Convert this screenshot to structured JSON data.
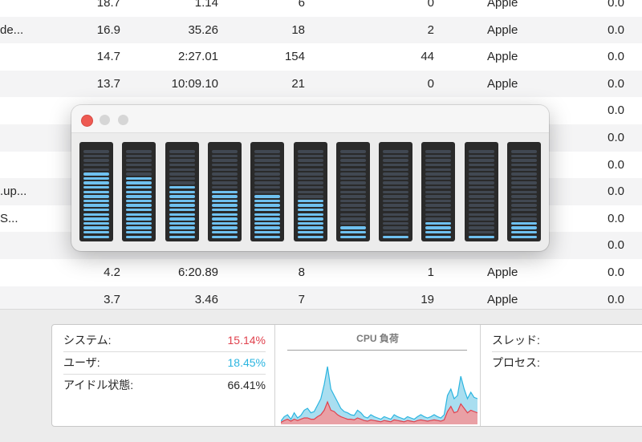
{
  "process_table": {
    "rows": [
      {
        "name": "",
        "cpu": "18.7",
        "time": "1.14",
        "threads": "6",
        "idle_wake": "0",
        "user": "Apple",
        "gpu": "0.0"
      },
      {
        "name": "de...",
        "cpu": "16.9",
        "time": "35.26",
        "threads": "18",
        "idle_wake": "2",
        "user": "Apple",
        "gpu": "0.0"
      },
      {
        "name": "",
        "cpu": "14.7",
        "time": "2:27.01",
        "threads": "154",
        "idle_wake": "44",
        "user": "Apple",
        "gpu": "0.0"
      },
      {
        "name": "",
        "cpu": "13.7",
        "time": "10:09.10",
        "threads": "21",
        "idle_wake": "0",
        "user": "Apple",
        "gpu": "0.0"
      },
      {
        "name": "",
        "cpu": "",
        "time": "",
        "threads": "",
        "idle_wake": "",
        "user": "",
        "gpu": "0.0"
      },
      {
        "name": "",
        "cpu": "",
        "time": "",
        "threads": "",
        "idle_wake": "",
        "user": "",
        "gpu": "0.0"
      },
      {
        "name": "",
        "cpu": "",
        "time": "",
        "threads": "",
        "idle_wake": "",
        "user": "",
        "gpu": "0.0"
      },
      {
        "name": ".up...",
        "cpu": "",
        "time": "",
        "threads": "",
        "idle_wake": "",
        "user": "",
        "gpu": "0.0"
      },
      {
        "name": "S...",
        "cpu": "",
        "time": "",
        "threads": "",
        "idle_wake": "",
        "user": "",
        "gpu": "0.0"
      },
      {
        "name": "",
        "cpu": "",
        "time": "",
        "threads": "",
        "idle_wake": "",
        "user": "",
        "gpu": "0.0"
      },
      {
        "name": "",
        "cpu": "4.2",
        "time": "6:20.89",
        "threads": "8",
        "idle_wake": "1",
        "user": "Apple",
        "gpu": "0.0"
      },
      {
        "name": "",
        "cpu": "3.7",
        "time": "3.46",
        "threads": "7",
        "idle_wake": "19",
        "user": "Apple",
        "gpu": "0.0"
      }
    ]
  },
  "cpu_panel": {
    "system_label": "システム:",
    "system_value": "15.14%",
    "user_label": "ユーザ:",
    "user_value": "18.45%",
    "idle_label": "アイドル状態:",
    "idle_value": "66.41%",
    "graph_title": "CPU 負荷",
    "threads_label": "スレッド:",
    "processes_label": "プロセス:",
    "colors": {
      "system": "#e0424e",
      "user": "#2bb5e0"
    },
    "load_history": {
      "user": [
        0.05,
        0.12,
        0.15,
        0.08,
        0.18,
        0.1,
        0.14,
        0.22,
        0.25,
        0.18,
        0.2,
        0.3,
        0.4,
        0.62,
        0.9,
        0.55,
        0.45,
        0.35,
        0.25,
        0.2,
        0.18,
        0.15,
        0.14,
        0.22,
        0.18,
        0.12,
        0.1,
        0.15,
        0.12,
        0.1,
        0.08,
        0.12,
        0.1,
        0.08,
        0.15,
        0.12,
        0.1,
        0.08,
        0.12,
        0.1,
        0.08,
        0.12,
        0.15,
        0.12,
        0.1,
        0.12,
        0.15,
        0.12,
        0.1,
        0.15,
        0.45,
        0.55,
        0.4,
        0.45,
        0.75,
        0.55,
        0.4,
        0.5,
        0.42,
        0.4
      ],
      "system": [
        0.03,
        0.06,
        0.08,
        0.05,
        0.08,
        0.06,
        0.08,
        0.1,
        0.1,
        0.08,
        0.08,
        0.12,
        0.15,
        0.22,
        0.35,
        0.22,
        0.2,
        0.15,
        0.12,
        0.1,
        0.08,
        0.08,
        0.07,
        0.1,
        0.08,
        0.06,
        0.05,
        0.07,
        0.06,
        0.05,
        0.04,
        0.06,
        0.05,
        0.04,
        0.07,
        0.06,
        0.05,
        0.04,
        0.06,
        0.05,
        0.04,
        0.06,
        0.07,
        0.06,
        0.05,
        0.06,
        0.07,
        0.06,
        0.05,
        0.07,
        0.2,
        0.28,
        0.18,
        0.2,
        0.32,
        0.25,
        0.18,
        0.22,
        0.2,
        0.18
      ]
    }
  },
  "cpu_history_window": {
    "segments_per_meter": 20,
    "core_lit_segments": [
      15,
      14,
      12,
      11,
      10,
      9,
      3,
      1,
      4,
      1,
      4
    ],
    "colors": {
      "lit": "#6fc1f0",
      "unlit": "#414852",
      "well": "#2a2a2a"
    }
  }
}
